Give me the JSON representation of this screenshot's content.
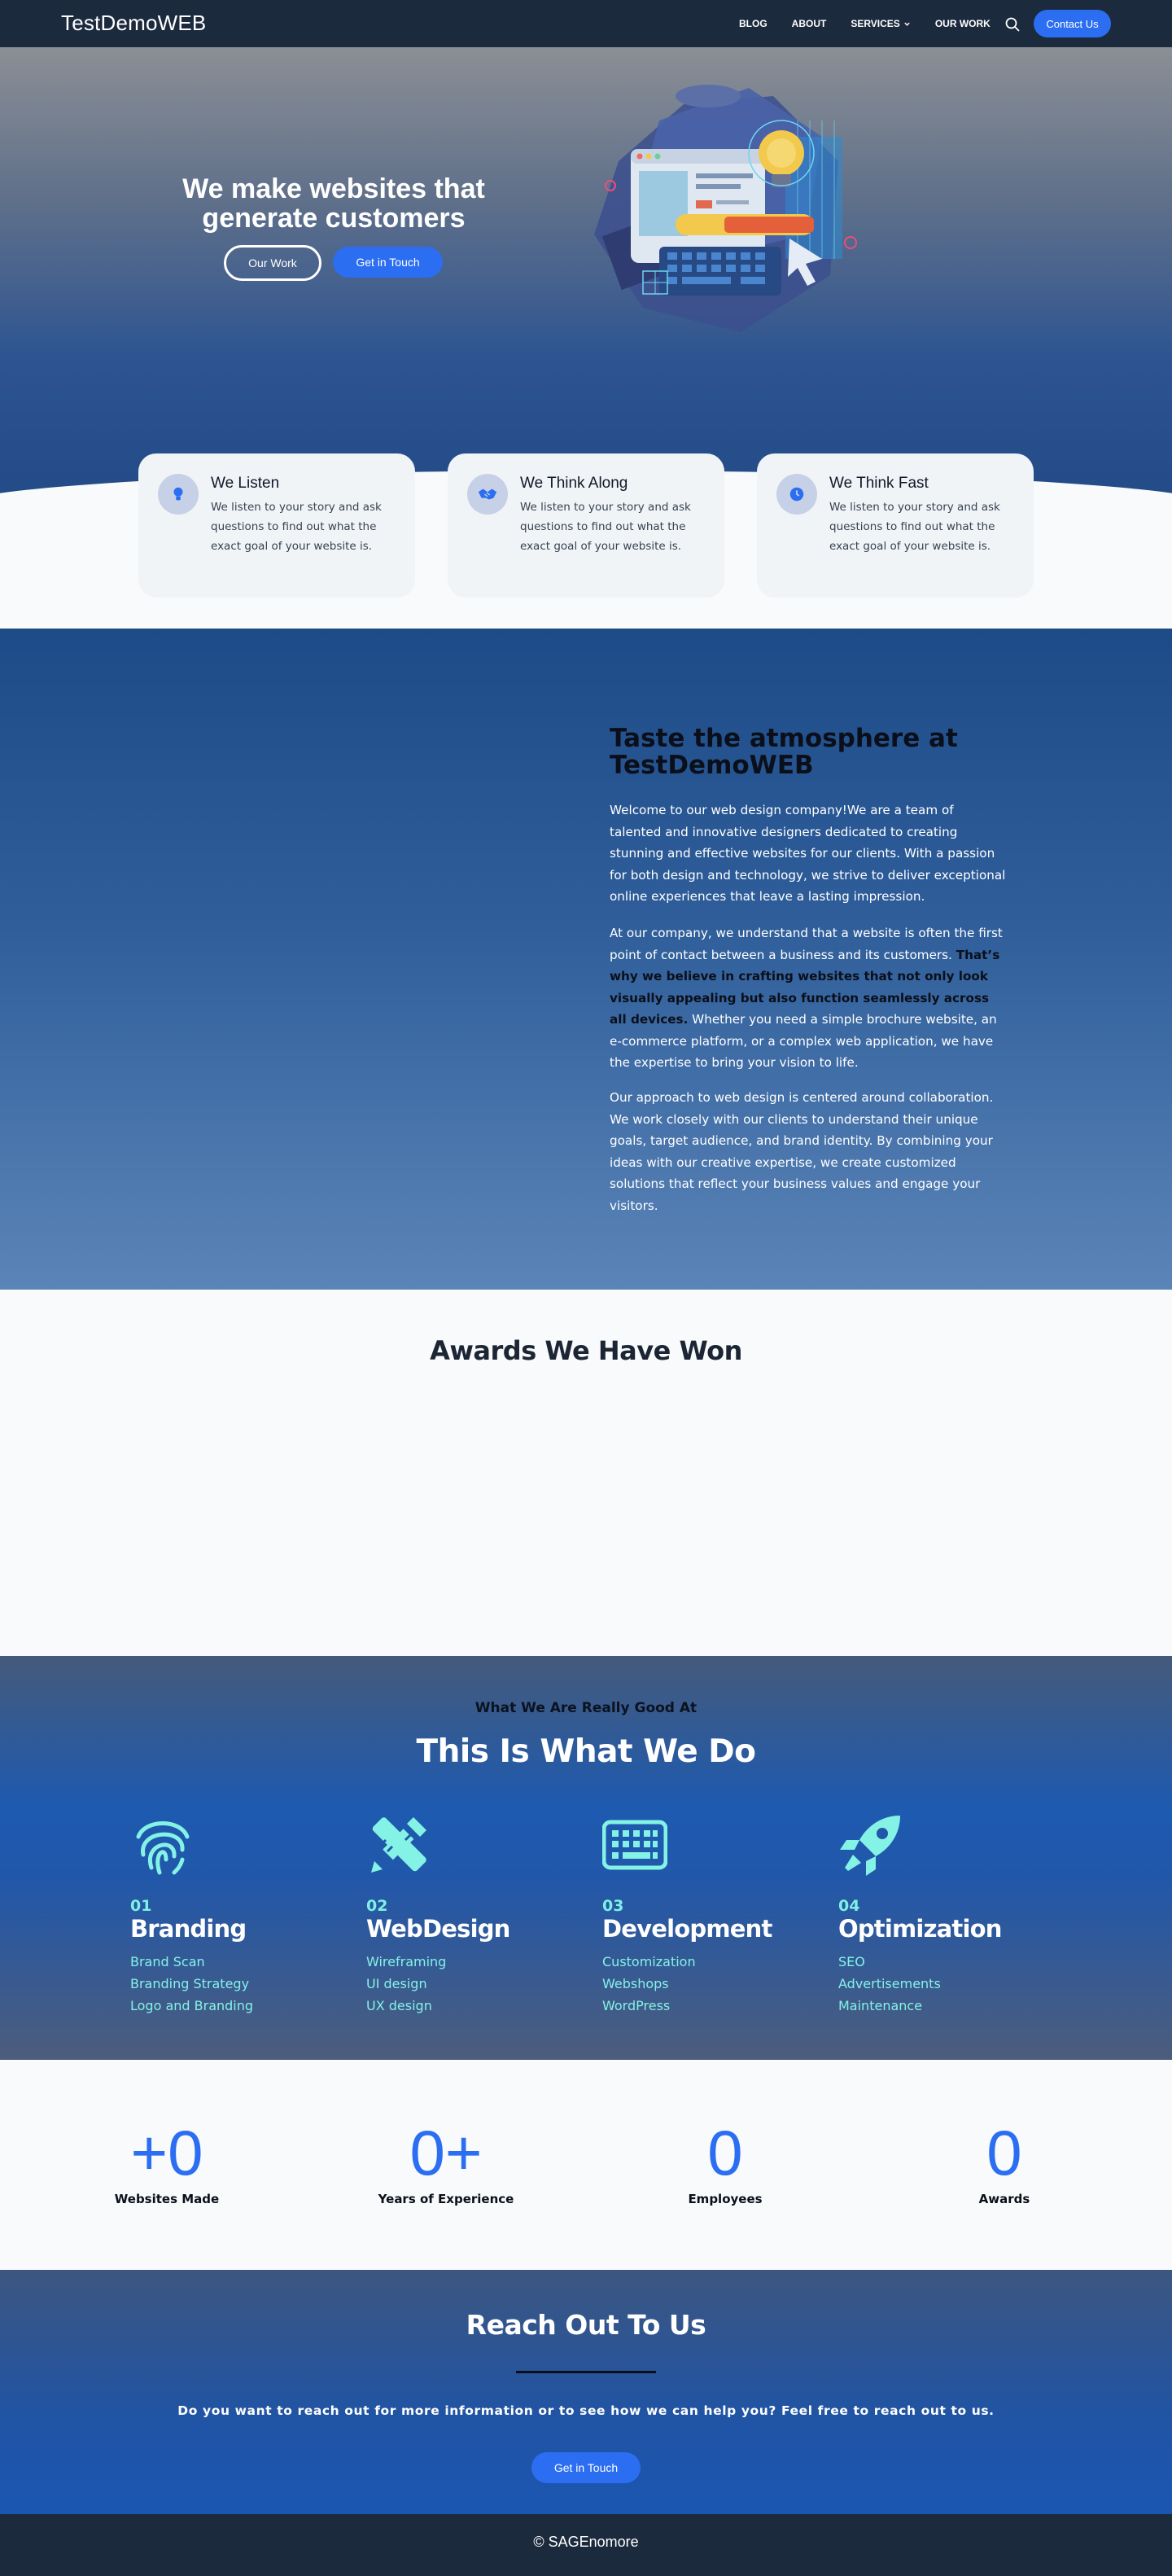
{
  "nav": {
    "brand": "TestDemoWEB",
    "links": [
      "BLOG",
      "ABOUT",
      "SERVICES",
      "OUR WORK"
    ],
    "cta": "Contact Us"
  },
  "hero": {
    "title": "We make websites that generate customers",
    "btn_our_work": "Our Work",
    "btn_get_in_touch": "Get in Touch"
  },
  "features": [
    {
      "title": "We Listen",
      "text": "We listen to your story and ask questions to find out what the exact goal of your website is.",
      "icon": "lightbulb-icon"
    },
    {
      "title": "We Think Along",
      "text": "We listen to your story and ask questions to find out what the exact goal of your website is.",
      "icon": "handshake-icon"
    },
    {
      "title": "We Think Fast",
      "text": "We listen to your story and ask questions to find out what the exact goal of your website is.",
      "icon": "clock-icon"
    }
  ],
  "about": {
    "title": "Taste the atmosphere at TestDemoWEB",
    "p1": "Welcome to our web design company!We are a team of talented and innovative designers dedicated to creating stunning and effective websites for our clients. With a passion for both design and technology, we strive to deliver exceptional online experiences that leave a lasting impression.",
    "p2_start": "At our company, we understand that a website is often the first point of contact between a business and its customers. ",
    "p2_bold": "That’s why we believe in crafting websites that not only look visually appealing but also function seamlessly across all devices.",
    "p2_end": " Whether you need a simple brochure website, an e-commerce platform, or a complex web application, we have the expertise to bring your vision to life.",
    "p3": "Our approach to web design is centered around collaboration. We work closely with our clients to understand their unique goals, target audience, and brand identity. By combining your ideas with our creative expertise, we create customized solutions that reflect your business values and engage your visitors."
  },
  "awards": {
    "title": "Awards We Have Won"
  },
  "services": {
    "kicker": "What We Are Really Good At",
    "title": "This Is What We Do",
    "items": [
      {
        "num": "01",
        "name": "Branding",
        "icon": "fingerprint-icon",
        "list": [
          "Brand Scan",
          "Branding Strategy",
          "Logo and Branding"
        ]
      },
      {
        "num": "02",
        "name": "WebDesign",
        "icon": "pencil-ruler-icon",
        "list": [
          "Wireframing",
          "UI design",
          "UX design"
        ]
      },
      {
        "num": "03",
        "name": "Development",
        "icon": "keyboard-icon",
        "list": [
          "Customization",
          "Webshops",
          "WordPress"
        ]
      },
      {
        "num": "04",
        "name": "Optimization",
        "icon": "rocket-icon",
        "list": [
          "SEO",
          "Advertisements",
          "Maintenance"
        ]
      }
    ]
  },
  "stats": [
    {
      "value": "+0",
      "label": "Websites Made"
    },
    {
      "value": "0+",
      "label": "Years of Experience"
    },
    {
      "value": "0",
      "label": "Employees"
    },
    {
      "value": "0",
      "label": "Awards"
    }
  ],
  "contact": {
    "title": "Reach Out To Us",
    "text": "Do you want to reach out for more information or to see how we can help you? Feel free to reach out to us.",
    "btn": "Get in Touch"
  },
  "footer": {
    "text": "© SAGEnomore"
  },
  "colors": {
    "accent": "#2b6ef2",
    "nav_bg": "#1c2a3e",
    "teal": "#84f2e5"
  }
}
